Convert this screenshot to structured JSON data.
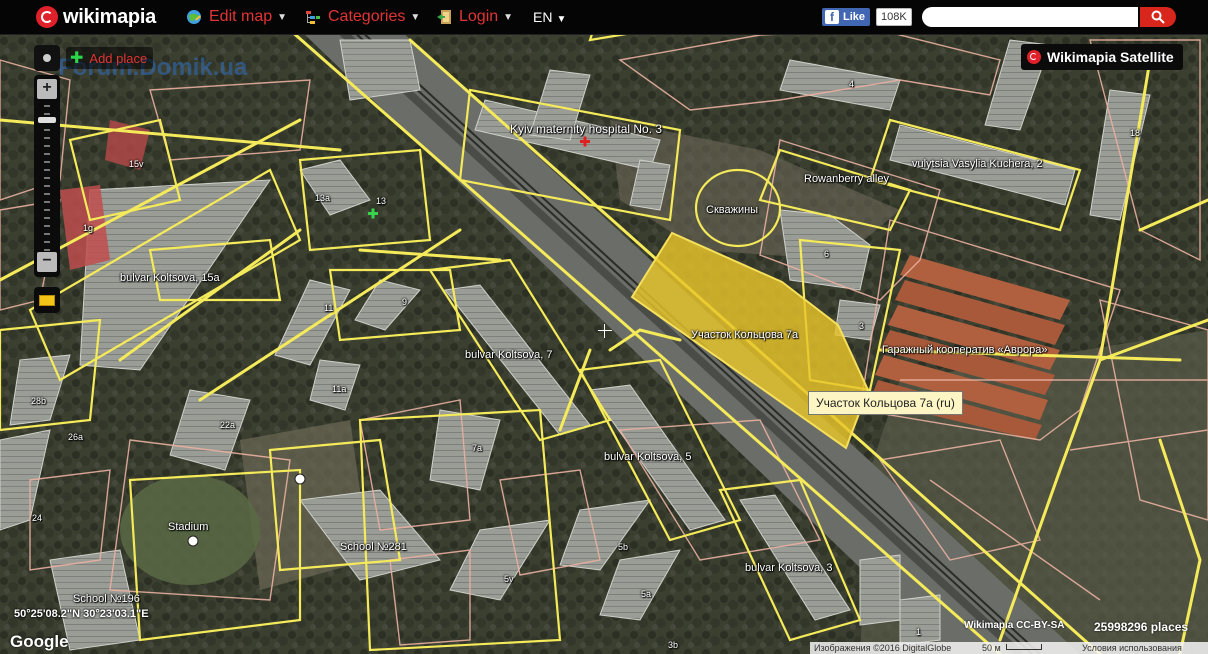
{
  "topbar": {
    "logo_text": "wikimapia",
    "edit_map": "Edit map",
    "categories": "Categories",
    "login": "Login",
    "language": "EN",
    "fb_like": "Like",
    "fb_count": "108K",
    "search_placeholder": ""
  },
  "map_type": "Wikimapia Satellite",
  "controls": {
    "add_place": "Add place",
    "zoom_in": "+",
    "zoom_out": "−"
  },
  "watermark": "Forum.Domik.ua",
  "tooltip": "Участок Кольцова 7а (ru)",
  "labels": {
    "hospital": "Kyiv maternity hospital No. 3",
    "kuchera": "vulytsia Vasylia Kuchera, 2",
    "rowanberry": "Rowanberry alley",
    "skvazhiny": "Скважины",
    "uchastok": "Участок Кольцова 7а",
    "garage": "Гаражный кооператив «Аврора»",
    "koltsova15a": "bulvar Koltsova, 15a",
    "koltsova7": "bulvar Koltsova, 7",
    "koltsova5": "bulvar Koltsova, 5",
    "koltsova3": "bulvar Koltsova, 3",
    "stadium": "Stadium",
    "school281": "School №281",
    "school196": "School №196",
    "n15v": "15v",
    "n1g": "1g",
    "n13": "13",
    "n13a": "13a",
    "n11": "11",
    "n9": "9",
    "n11a": "11a",
    "n22a": "22a",
    "n7a": "7a",
    "n28b": "28b",
    "n26a": "26a",
    "n24": "24",
    "n5b": "5b",
    "n5v": "5v",
    "n5a": "5a",
    "n3b": "3b",
    "n6": "6",
    "n3": "3",
    "n4": "4",
    "n18": "18",
    "n1": "1"
  },
  "coordinates": "50°25'08.2\"N 30°23'03.1\"E",
  "attribution": {
    "google": "Google",
    "license": "Wikimapia CC-BY-SA",
    "places": "25998296 places",
    "imagery": "Изображения ©2016 DigitalGlobe",
    "scale": "50 м",
    "terms": "Условия использования"
  },
  "colors": {
    "topbar_bg": "#050505",
    "menu_red": "#e23434",
    "road_yellow": "#f4ea5a",
    "border_pink": "#e9b0a0",
    "highlight_fill": "#e8c52a",
    "tooltip_bg": "#fdf6c4"
  }
}
